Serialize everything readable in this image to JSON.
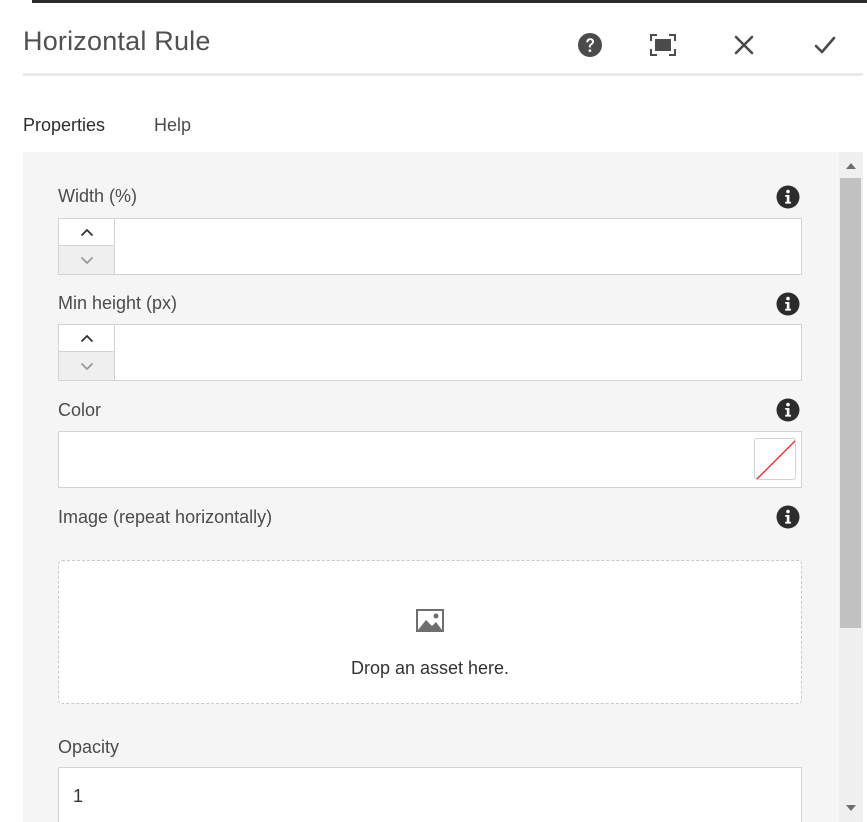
{
  "dialog": {
    "title": "Horizontal Rule",
    "actions": {
      "help_icon": "help-circle-icon",
      "fullscreen_icon": "fullscreen-icon",
      "close_icon": "close-icon",
      "done_icon": "checkmark-icon"
    }
  },
  "tabs": [
    {
      "label": "Properties",
      "active": true
    },
    {
      "label": "Help",
      "active": false
    }
  ],
  "fields": {
    "width": {
      "label": "Width (%)",
      "value": ""
    },
    "min_height": {
      "label": "Min height (px)",
      "value": ""
    },
    "color": {
      "label": "Color",
      "value": ""
    },
    "image": {
      "label": "Image (repeat horizontally)",
      "drop_text": "Drop an asset here."
    },
    "opacity": {
      "label": "Opacity",
      "value": "1"
    }
  },
  "colors": {
    "accent": "#2c2c2c",
    "swatch_none_line": "#d7373f",
    "field_border": "#d3d3d3",
    "panel_bg": "#f5f5f5"
  }
}
